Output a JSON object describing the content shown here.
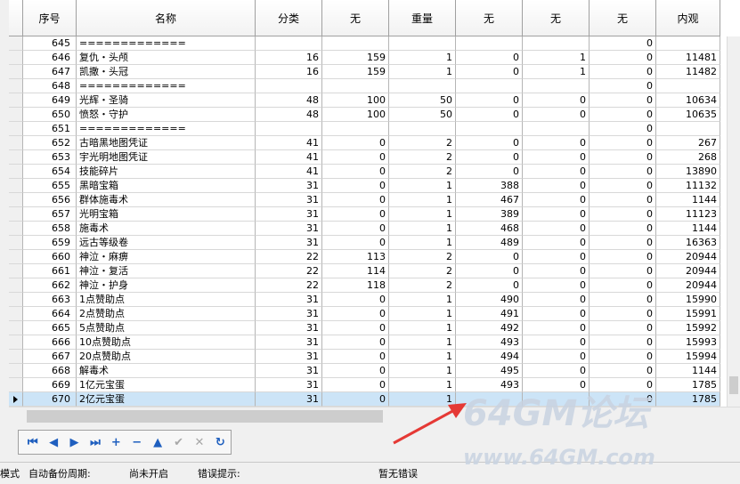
{
  "columns": [
    "序号",
    "名称",
    "分类",
    "无",
    "重量",
    "无",
    "无",
    "无",
    "内观"
  ],
  "rows": [
    [
      "645",
      "=============",
      "",
      "",
      "",
      "",
      "",
      "0",
      ""
    ],
    [
      "646",
      "复仇・头颅",
      "16",
      "159",
      "1",
      "0",
      "1",
      "0",
      "11481"
    ],
    [
      "647",
      "凯撒・头冠",
      "16",
      "159",
      "1",
      "0",
      "1",
      "0",
      "11482"
    ],
    [
      "648",
      "=============",
      "",
      "",
      "",
      "",
      "",
      "0",
      ""
    ],
    [
      "649",
      "光辉・圣骑",
      "48",
      "100",
      "50",
      "0",
      "0",
      "0",
      "10634"
    ],
    [
      "650",
      "愤怒・守护",
      "48",
      "100",
      "50",
      "0",
      "0",
      "0",
      "10635"
    ],
    [
      "651",
      "=============",
      "",
      "",
      "",
      "",
      "",
      "0",
      ""
    ],
    [
      "652",
      "古暗黑地图凭证",
      "41",
      "0",
      "2",
      "0",
      "0",
      "0",
      "267"
    ],
    [
      "653",
      "宇光明地图凭证",
      "41",
      "0",
      "2",
      "0",
      "0",
      "0",
      "268"
    ],
    [
      "654",
      "技能碎片",
      "41",
      "0",
      "2",
      "0",
      "0",
      "0",
      "13890"
    ],
    [
      "655",
      "黑暗宝箱",
      "31",
      "0",
      "1",
      "388",
      "0",
      "0",
      "11132"
    ],
    [
      "656",
      "群体施毒术",
      "31",
      "0",
      "1",
      "467",
      "0",
      "0",
      "1144"
    ],
    [
      "657",
      "光明宝箱",
      "31",
      "0",
      "1",
      "389",
      "0",
      "0",
      "11123"
    ],
    [
      "658",
      "施毒术",
      "31",
      "0",
      "1",
      "468",
      "0",
      "0",
      "1144"
    ],
    [
      "659",
      "远古等级卷",
      "31",
      "0",
      "1",
      "489",
      "0",
      "0",
      "16363"
    ],
    [
      "660",
      "神泣・麻痹",
      "22",
      "113",
      "2",
      "0",
      "0",
      "0",
      "20944"
    ],
    [
      "661",
      "神泣・复活",
      "22",
      "114",
      "2",
      "0",
      "0",
      "0",
      "20944"
    ],
    [
      "662",
      "神泣・护身",
      "22",
      "118",
      "2",
      "0",
      "0",
      "0",
      "20944"
    ],
    [
      "663",
      "1点赞助点",
      "31",
      "0",
      "1",
      "490",
      "0",
      "0",
      "15990"
    ],
    [
      "664",
      "2点赞助点",
      "31",
      "0",
      "1",
      "491",
      "0",
      "0",
      "15991"
    ],
    [
      "665",
      "5点赞助点",
      "31",
      "0",
      "1",
      "492",
      "0",
      "0",
      "15992"
    ],
    [
      "666",
      "10点赞助点",
      "31",
      "0",
      "1",
      "493",
      "0",
      "0",
      "15993"
    ],
    [
      "667",
      "20点赞助点",
      "31",
      "0",
      "1",
      "494",
      "0",
      "0",
      "15994"
    ],
    [
      "668",
      "解毒术",
      "31",
      "0",
      "1",
      "495",
      "0",
      "0",
      "1144"
    ],
    [
      "669",
      "1亿元宝蛋",
      "31",
      "0",
      "1",
      "493",
      "0",
      "0",
      "1785"
    ],
    [
      "670",
      "2亿元宝蛋",
      "31",
      "0",
      "1",
      "",
      "",
      "0",
      "1785"
    ]
  ],
  "selected_row_index": 25,
  "nav_buttons": [
    {
      "icon": "first-icon",
      "glyph": "⏮",
      "enabled": true
    },
    {
      "icon": "prior-icon",
      "glyph": "◀",
      "enabled": true
    },
    {
      "icon": "next-icon",
      "glyph": "▶",
      "enabled": true
    },
    {
      "icon": "last-icon",
      "glyph": "⏭",
      "enabled": true
    },
    {
      "icon": "insert-icon",
      "glyph": "+",
      "enabled": true
    },
    {
      "icon": "delete-icon",
      "glyph": "−",
      "enabled": true
    },
    {
      "icon": "edit-icon",
      "glyph": "▲",
      "enabled": true
    },
    {
      "icon": "post-icon",
      "glyph": "✔",
      "enabled": false
    },
    {
      "icon": "cancel-icon",
      "glyph": "✕",
      "enabled": false
    },
    {
      "icon": "refresh-icon",
      "glyph": "↻",
      "enabled": true
    }
  ],
  "status": {
    "mode": "模式",
    "backup_label": "自动备份周期:",
    "backup_value": "尚未开启",
    "error_label": "错误提示:",
    "error_value": "暂无错误"
  },
  "watermark": {
    "main": "64GM论坛",
    "url": "www.64GM.com"
  },
  "colors": {
    "accent": "#1f5fbf",
    "selected": "#cce4f7",
    "arrow": "#e53935"
  }
}
